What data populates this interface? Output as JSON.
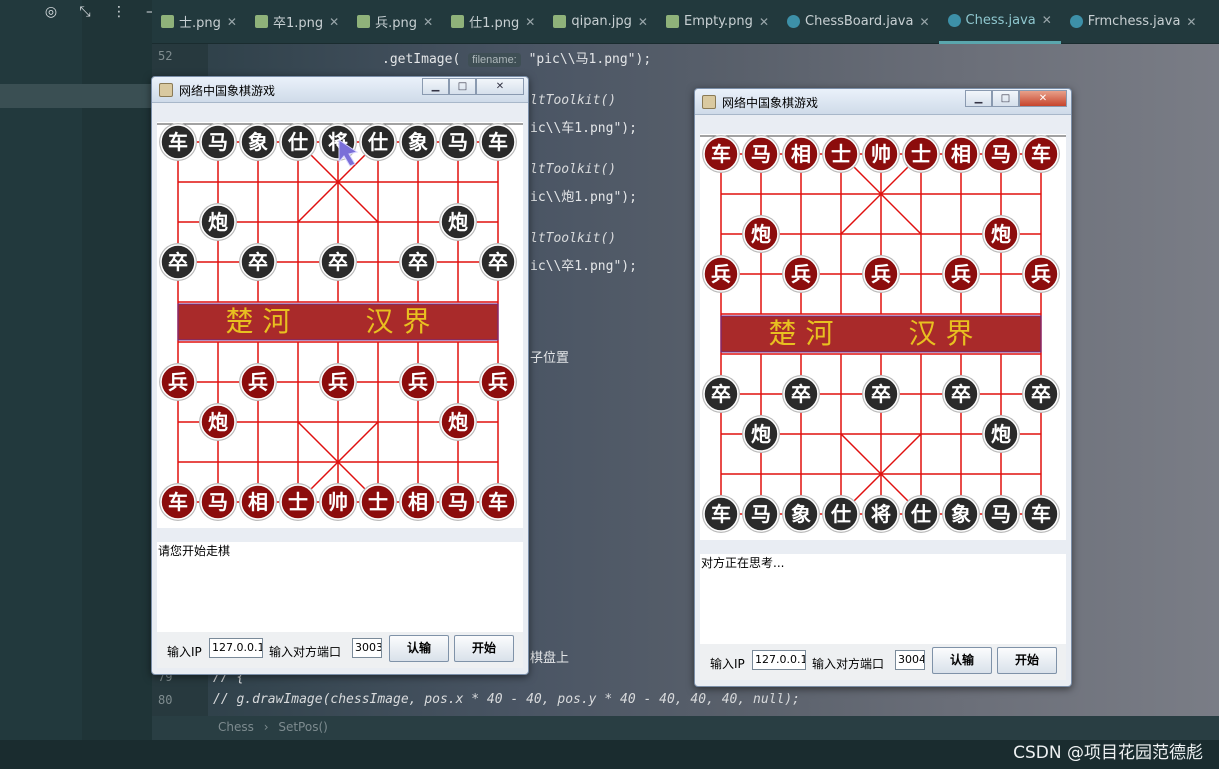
{
  "tabs": [
    {
      "label": "士.png",
      "kind": "img"
    },
    {
      "label": "卒1.png",
      "kind": "img"
    },
    {
      "label": "兵.png",
      "kind": "img"
    },
    {
      "label": "仕1.png",
      "kind": "img"
    },
    {
      "label": "qipan.jpg",
      "kind": "img"
    },
    {
      "label": "Empty.png",
      "kind": "img"
    },
    {
      "label": "ChessBoard.java",
      "kind": "java"
    },
    {
      "label": "Chess.java",
      "kind": "java"
    },
    {
      "label": "Frmchess.java",
      "kind": "java"
    }
  ],
  "active_tab": "Chess.java",
  "editor": {
    "line_52": "52",
    "line_79": "79",
    "line_80": "80",
    "code_getimage": ".getImage(",
    "hint_filename": "filename:",
    "code_path1": "\"pic\\\\马1.png\");",
    "code_toolkit": "ltToolkit()",
    "code_path_che": "ic\\\\车1.png\");",
    "code_path_pao": "ic\\\\炮1.png\");",
    "code_path_zu": "ic\\\\卒1.png\");",
    "code_weizhi": "子位置",
    "code_qipan": "棋盘上",
    "code_comment1": "//  {",
    "code_comment2": "//      g.drawImage(chessImage, pos.x * 40 - 40, pos.y * 40 - 40, 40, 40, null);"
  },
  "breadcrumb": {
    "class": "Chess",
    "method": "SetPos()"
  },
  "watermark": "CSDN @项目花园范德彪",
  "colors": {
    "red_piece": "#8c0d0d",
    "black_piece": "#2a2a2a",
    "river_band": "#a92a2a",
    "river_text": "#e8c020",
    "grid_line": "#e0100f"
  },
  "windows": [
    {
      "title": "网络中国象棋游戏",
      "status_message": "请您开始走棋",
      "ip_label": "输入IP",
      "ip_value": "127.0.0.1",
      "port_label": "输入对方端口",
      "port_value": "3003",
      "resign_label": "认输",
      "start_label": "开始",
      "river_left": "楚 河",
      "river_right": "汉 界",
      "pieces_top_black": [
        "车",
        "马",
        "象",
        "仕",
        "将",
        "仕",
        "象",
        "马",
        "车"
      ],
      "pieces_black_cannons": [
        "炮",
        "炮"
      ],
      "pieces_black_soldiers": [
        "卒",
        "卒",
        "卒",
        "卒",
        "卒"
      ],
      "pieces_red_soldiers": [
        "兵",
        "兵",
        "兵",
        "兵",
        "兵"
      ],
      "pieces_red_cannons": [
        "炮",
        "炮"
      ],
      "pieces_bottom_red": [
        "车",
        "马",
        "相",
        "士",
        "帅",
        "士",
        "相",
        "马",
        "车"
      ]
    },
    {
      "title": "网络中国象棋游戏",
      "status_message": "对方正在思考...",
      "ip_label": "输入IP",
      "ip_value": "127.0.0.1",
      "port_label": "输入对方端口",
      "port_value": "3004",
      "resign_label": "认输",
      "start_label": "开始",
      "river_left": "楚 河",
      "river_right": "汉 界",
      "pieces_top_red": [
        "车",
        "马",
        "相",
        "士",
        "帅",
        "士",
        "相",
        "马",
        "车"
      ],
      "pieces_red_cannons": [
        "炮",
        "炮"
      ],
      "pieces_red_soldiers": [
        "兵",
        "兵",
        "兵",
        "兵",
        "兵"
      ],
      "pieces_black_soldiers": [
        "卒",
        "卒",
        "卒",
        "卒",
        "卒"
      ],
      "pieces_black_cannons": [
        "炮",
        "炮"
      ],
      "pieces_bottom_black": [
        "车",
        "马",
        "象",
        "仕",
        "将",
        "仕",
        "象",
        "马",
        "车"
      ]
    }
  ]
}
